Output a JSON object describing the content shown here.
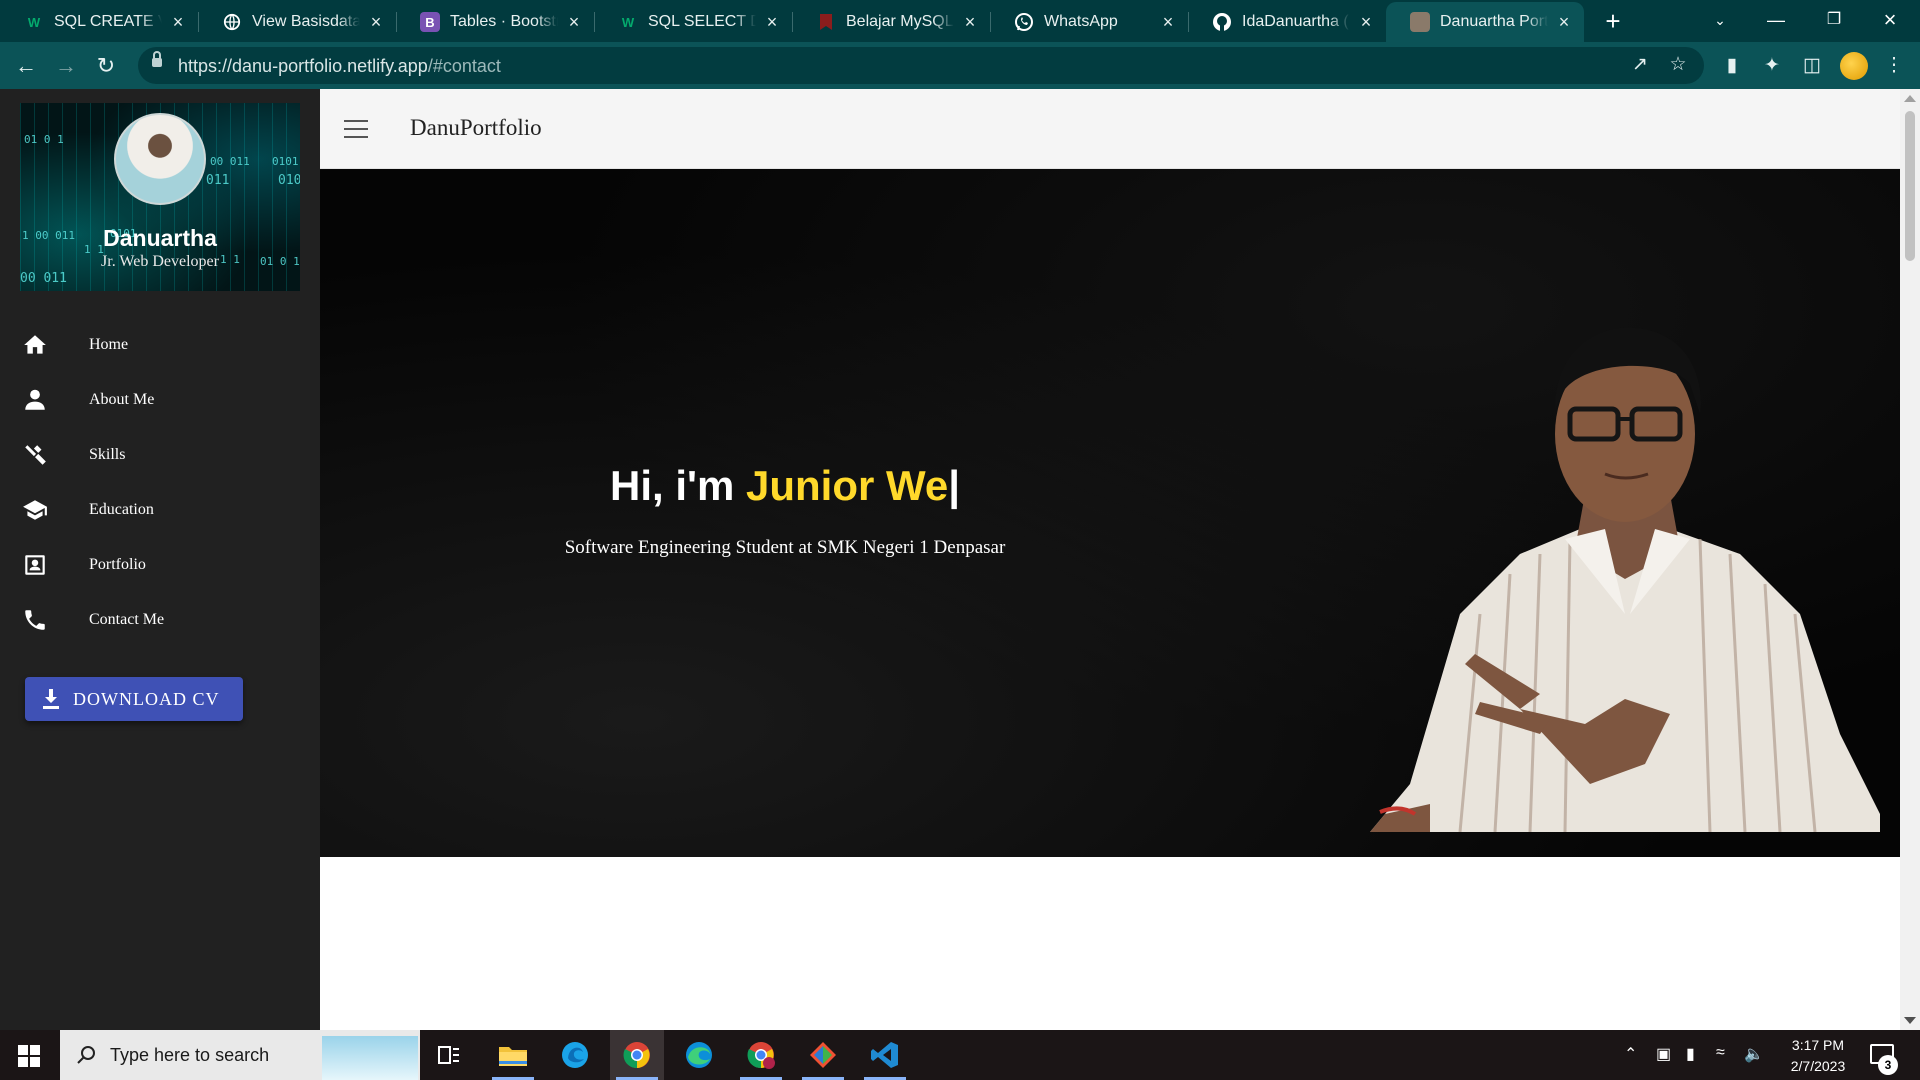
{
  "browser": {
    "tabs": [
      {
        "title": "SQL CREATE VIEW",
        "icon": "w3schools-icon",
        "color": "#04aa6d"
      },
      {
        "title": "View Basisdata",
        "icon": "globe-icon",
        "color": "#ffffff"
      },
      {
        "title": "Tables · Bootstrap",
        "icon": "bootstrap-icon",
        "color": "#7952b3"
      },
      {
        "title": "SQL SELECT DISTINCT",
        "icon": "w3schools-icon",
        "color": "#04aa6d"
      },
      {
        "title": "Belajar MySQL Lanjutan",
        "icon": "bookmark-icon",
        "color": "#c0392b"
      },
      {
        "title": "WhatsApp",
        "icon": "whatsapp-icon",
        "color": "#25d366"
      },
      {
        "title": "IdaDanuartha (Ida Danuartha)",
        "icon": "github-icon",
        "color": "#ffffff"
      },
      {
        "title": "Danuartha Portfolio",
        "icon": "portfolio-icon",
        "color": "#8a7a6a"
      }
    ],
    "active_tab": 7,
    "url_host": "https://danu-portfolio.netlify.app",
    "url_path": "/#contact"
  },
  "sidebar": {
    "name": "Danuartha",
    "role": "Jr. Web Developer",
    "items": [
      {
        "label": "Home",
        "icon": "home-icon"
      },
      {
        "label": "About Me",
        "icon": "person-icon"
      },
      {
        "label": "Skills",
        "icon": "tools-icon"
      },
      {
        "label": "Education",
        "icon": "graduation-cap-icon"
      },
      {
        "label": "Portfolio",
        "icon": "portfolio-icon"
      },
      {
        "label": "Contact Me",
        "icon": "phone-icon"
      }
    ],
    "download_label": "DOWNLOAD CV"
  },
  "appbar": {
    "brand": "DanuPortfolio"
  },
  "hero": {
    "greeting": "Hi, i'm ",
    "typed_text": "Junior We",
    "cursor": "|",
    "subtitle": "Software Engineering Student at SMK Negeri 1 Denpasar"
  },
  "taskbar": {
    "search_placeholder": "Type here to search",
    "time": "3:17 PM",
    "date": "2/7/2023",
    "notifications": "3"
  },
  "colors": {
    "tab_bg": "#013a3e",
    "toolbar_bg": "#0b5357",
    "sidebar_bg": "#212121",
    "accent_button": "#3f51b5",
    "hero_highlight": "#ffd92b"
  }
}
